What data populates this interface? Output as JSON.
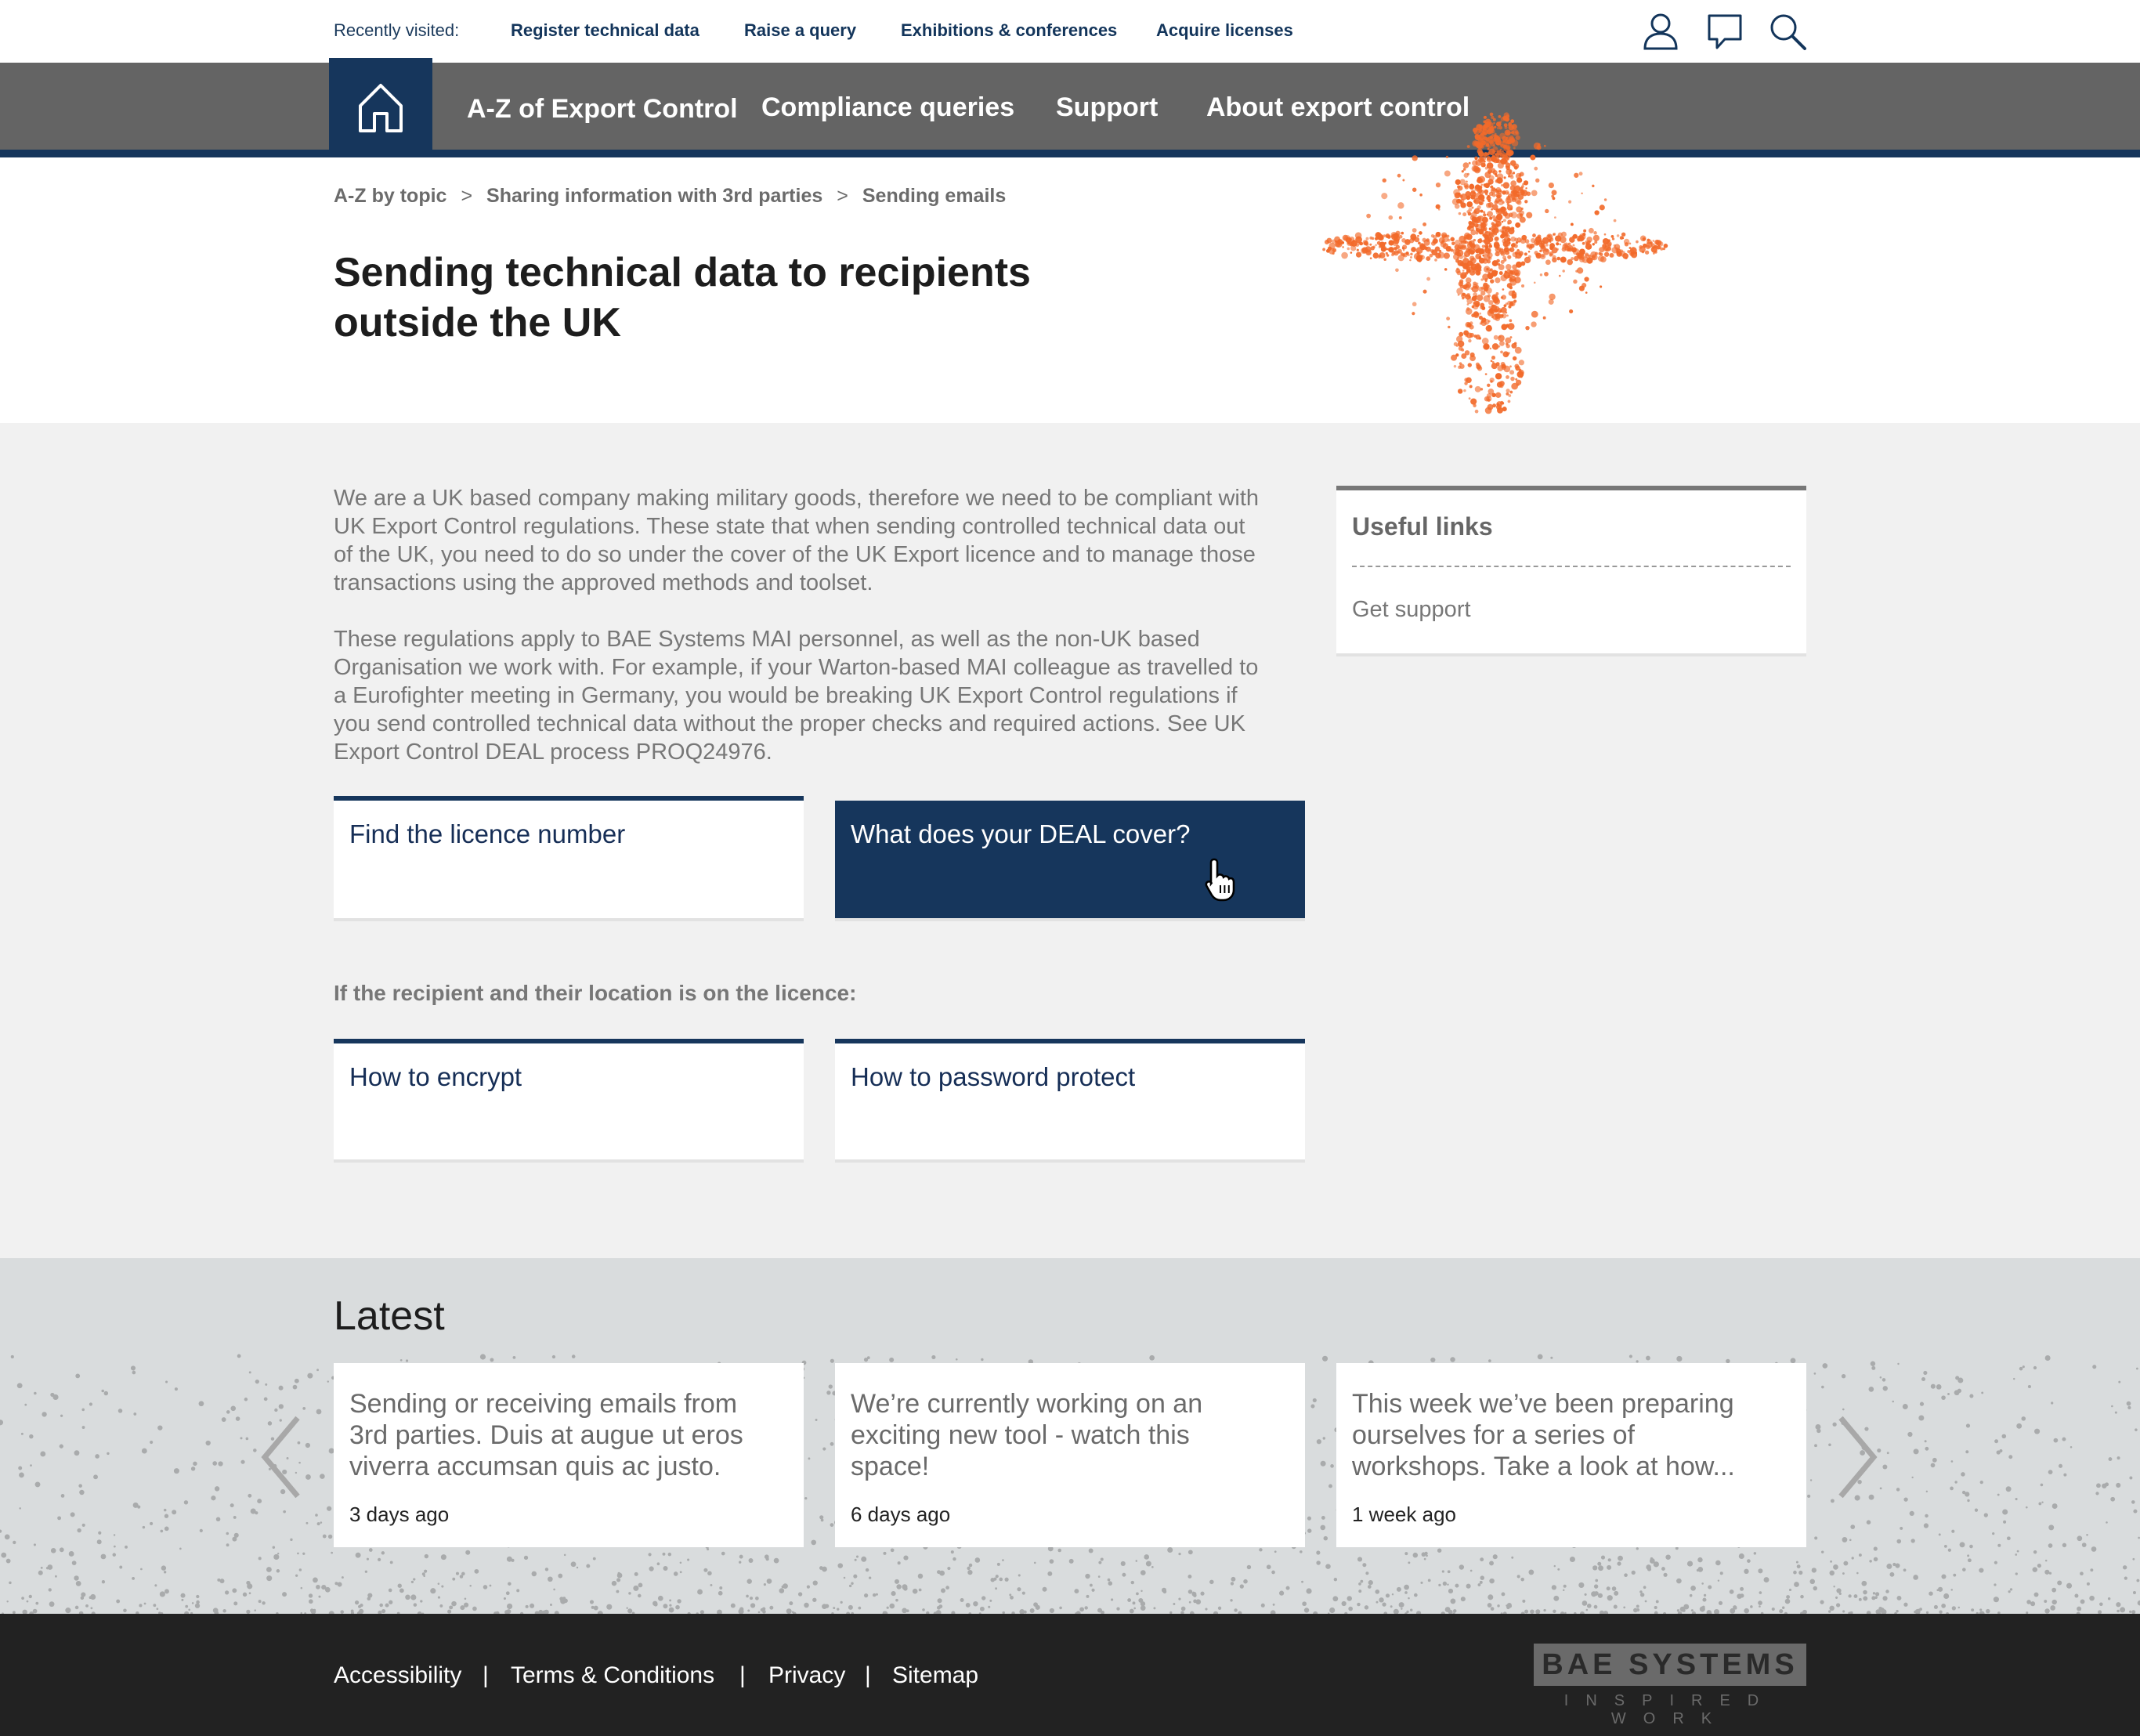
{
  "colors": {
    "navy": "#16365c",
    "nav_gray": "#646464",
    "accent_orange": "#f26a2a",
    "content_bg": "#f1f1f1",
    "latest_bg": "#d9dcdd",
    "footer_bg": "#222222"
  },
  "top_bar": {
    "recently_visited_label": "Recently visited:",
    "links": [
      "Register technical data",
      "Raise a query",
      "Exhibitions & conferences",
      "Acquire licenses"
    ],
    "icons": [
      "user-icon",
      "comment-icon",
      "search-icon"
    ]
  },
  "nav": {
    "home_icon": "home-icon",
    "items": [
      "A-Z of Export Control",
      "Compliance queries",
      "Support",
      "About export control"
    ]
  },
  "breadcrumb": {
    "items": [
      "A-Z by topic",
      "Sharing information with 3rd parties",
      "Sending emails"
    ],
    "separator": ">"
  },
  "page": {
    "title_line1": "Sending technical data to recipients",
    "title_line2": "outside the UK"
  },
  "content": {
    "para1": [
      "We are a UK based company making military goods, therefore we need to be compliant with",
      "UK Export Control regulations. These state that when sending controlled technical data out",
      "of the UK, you need to do so under the cover of the UK Export licence and to manage those",
      "transactions using the approved methods and toolset."
    ],
    "para2": [
      "These regulations apply to BAE Systems MAI personnel, as well as the non-UK based",
      "Organisation we work with. For example, if your Warton-based MAI colleague as travelled to",
      "a Eurofighter meeting in Germany, you would be breaking UK Export Control regulations if",
      "you send controlled technical data without the proper checks and required actions. See UK",
      "Export Control DEAL process PROQ24976."
    ],
    "cards_row1": [
      "Find the licence number",
      "What does your DEAL cover?"
    ],
    "section_label": "If the recipient and their location is on the licence:",
    "cards_row2": [
      "How to encrypt",
      "How to password protect"
    ]
  },
  "useful_links": {
    "title": "Useful links",
    "links": [
      "Get support"
    ]
  },
  "latest": {
    "title": "Latest",
    "items": [
      {
        "lines": [
          "Sending or receiving emails from",
          "3rd parties. Duis at augue ut eros",
          "viverra accumsan quis ac justo."
        ],
        "time": "3 days ago"
      },
      {
        "lines": [
          "We’re currently working on an",
          "exciting new tool - watch this",
          "space!"
        ],
        "time": "6 days ago"
      },
      {
        "lines": [
          "This week we’ve been preparing",
          "ourselves for a series of",
          "workshops. Take a look at how..."
        ],
        "time": "1 week ago"
      }
    ],
    "prev_icon": "chevron-left-icon",
    "next_icon": "chevron-right-icon"
  },
  "footer": {
    "links": [
      "Accessibility",
      "Terms & Conditions",
      "Privacy",
      "Sitemap"
    ],
    "separator": "|",
    "logo_text": "BAE SYSTEMS",
    "logo_tagline": "INSPIRED WORK"
  }
}
